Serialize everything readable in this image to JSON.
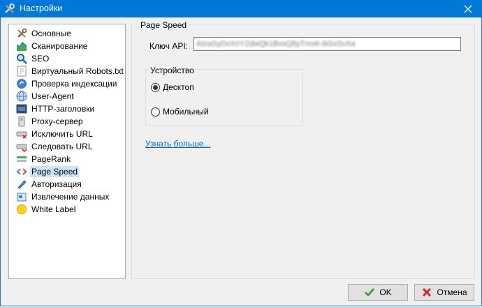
{
  "window": {
    "title": "Настройки"
  },
  "sidebar": {
    "items": [
      {
        "label": "Основные",
        "icon": "tools-icon"
      },
      {
        "label": "Сканирование",
        "icon": "scan-icon"
      },
      {
        "label": "SEO",
        "icon": "magnifier-icon"
      },
      {
        "label": "Виртуальный Robots.txt",
        "icon": "robots-file-icon"
      },
      {
        "label": "Проверка индексации",
        "icon": "index-check-icon"
      },
      {
        "label": "User-Agent",
        "icon": "globe-icon"
      },
      {
        "label": "HTTP-заголовки",
        "icon": "http-headers-icon"
      },
      {
        "label": "Proxy-сервер",
        "icon": "proxy-icon"
      },
      {
        "label": "Исключить URL",
        "icon": "exclude-url-icon"
      },
      {
        "label": "Следовать URL",
        "icon": "follow-url-icon"
      },
      {
        "label": "PageRank",
        "icon": "pagerank-icon"
      },
      {
        "label": "Page Speed",
        "icon": "code-tags-icon",
        "selected": true
      },
      {
        "label": "Авторизация",
        "icon": "pen-icon"
      },
      {
        "label": "Извлечение данных",
        "icon": "data-extract-icon"
      },
      {
        "label": "White Label",
        "icon": "sun-icon"
      }
    ]
  },
  "page_speed": {
    "section_title": "Page Speed",
    "api_label": "Ключ API:",
    "api_value": "AIzaSyDxXnYZdwQk1BvsQ8yTmxK-bGxSvXa",
    "device_group_title": "Устройство",
    "options": [
      {
        "label": "Десктоп",
        "checked": true
      },
      {
        "label": "Мобильный",
        "checked": false
      }
    ],
    "learn_more": "Узнать больше..."
  },
  "buttons": {
    "ok": "OK",
    "cancel": "Отмена"
  },
  "colors": {
    "titlebar": "#0078d7",
    "selection": "#cce4f7",
    "link": "#0066cc"
  }
}
